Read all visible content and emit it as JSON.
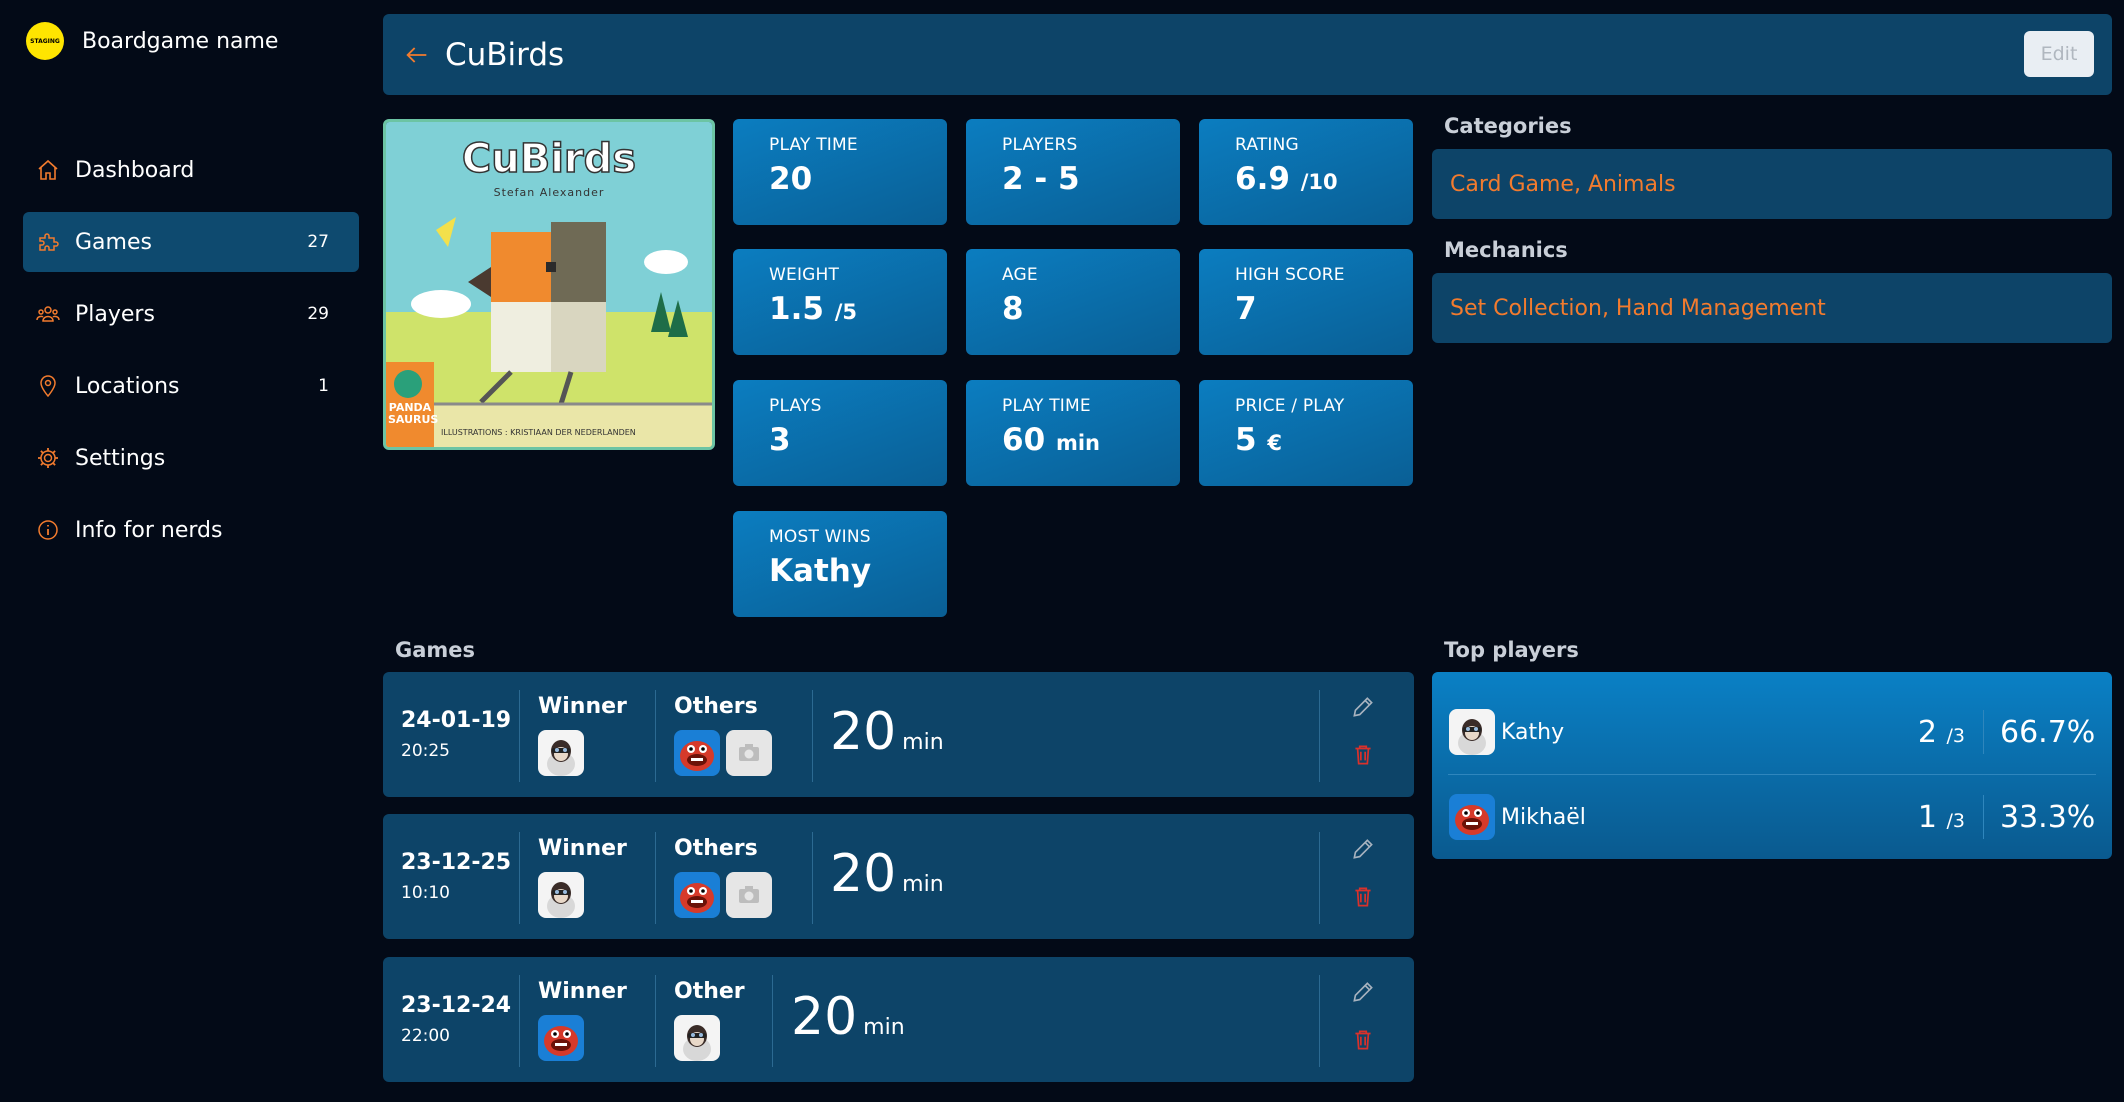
{
  "brand": {
    "logo_text": "STAGING",
    "name": "Boardgame name"
  },
  "nav": [
    {
      "label": "Dashboard",
      "count": "",
      "icon": "home-icon"
    },
    {
      "label": "Games",
      "count": "27",
      "icon": "puzzle-icon"
    },
    {
      "label": "Players",
      "count": "29",
      "icon": "players-icon"
    },
    {
      "label": "Locations",
      "count": "1",
      "icon": "location-icon"
    },
    {
      "label": "Settings",
      "count": "",
      "icon": "gear-icon"
    },
    {
      "label": "Info for nerds",
      "count": "",
      "icon": "info-icon"
    }
  ],
  "header": {
    "title": "CuBirds",
    "edit_label": "Edit"
  },
  "cover": {
    "title": "CuBirds",
    "author": "Stefan Alexander",
    "credits": "ILLUSTRATIONS : KRISTIAAN DER NEDERLANDEN",
    "publisher": "PANDA SAURUS"
  },
  "stats": {
    "play_time_label": "PLAY TIME",
    "play_time": "20",
    "players_label": "PLAYERS",
    "players": "2 - 5",
    "rating_label": "RATING",
    "rating": "6.9",
    "rating_unit": "/10",
    "weight_label": "WEIGHT",
    "weight": "1.5",
    "weight_unit": "/5",
    "age_label": "AGE",
    "age": "8",
    "high_score_label": "HIGH SCORE",
    "high_score": "7",
    "plays_label": "PLAYS",
    "plays": "3",
    "total_time_label": "PLAY TIME",
    "total_time": "60",
    "total_time_unit": "min",
    "price_label": "PRICE / PLAY",
    "price": "5",
    "price_unit": "€",
    "most_wins_label": "MOST WINS",
    "most_wins": "Kathy"
  },
  "categories": {
    "title": "Categories",
    "value": "Card Game, Animals"
  },
  "mechanics": {
    "title": "Mechanics",
    "value": "Set Collection, Hand Management"
  },
  "games_section": {
    "title": "Games"
  },
  "games": [
    {
      "date": "24-01-19",
      "time": "20:25",
      "winner_label": "Winner",
      "others_label": "Others",
      "duration": "20",
      "unit": "min"
    },
    {
      "date": "23-12-25",
      "time": "10:10",
      "winner_label": "Winner",
      "others_label": "Others",
      "duration": "20",
      "unit": "min"
    },
    {
      "date": "23-12-24",
      "time": "22:00",
      "winner_label": "Winner",
      "others_label": "Other",
      "duration": "20",
      "unit": "min"
    }
  ],
  "top_players": {
    "title": "Top players",
    "rows": [
      {
        "name": "Kathy",
        "wins": "2",
        "of": "/3",
        "pct": "66.7%"
      },
      {
        "name": "Mikhaël",
        "wins": "1",
        "of": "/3",
        "pct": "33.3%"
      }
    ]
  },
  "colors": {
    "accent": "#f27b2e",
    "panel": "#0d4468",
    "bg": "#030a17",
    "delete": "#d9312b"
  }
}
